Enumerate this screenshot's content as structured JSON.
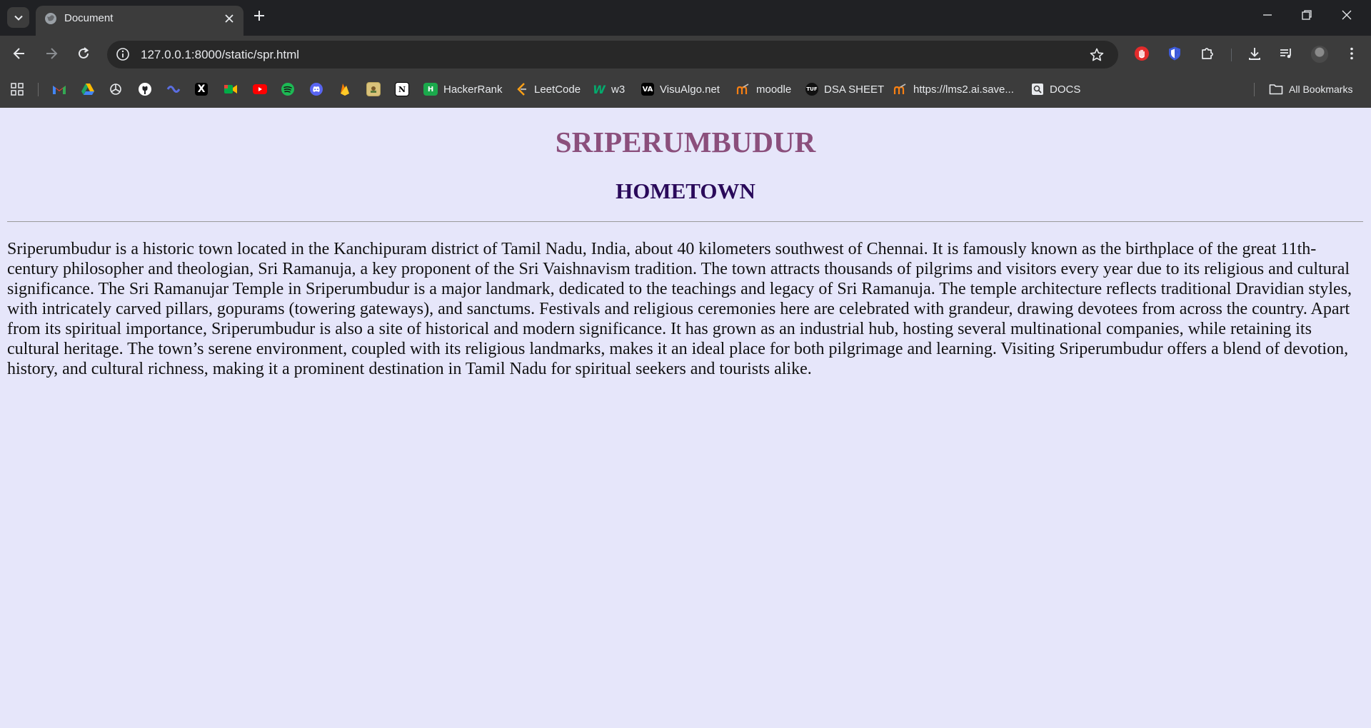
{
  "browser": {
    "tab": {
      "title": "Document"
    },
    "omnibox": {
      "url": "127.0.0.1:8000/static/spr.html"
    },
    "bookmarks": [
      {
        "label": "",
        "icon": "apps-grid-icon"
      },
      {
        "label": "",
        "icon": "gmail-icon",
        "color": "#ea4335"
      },
      {
        "label": "",
        "icon": "google-drive-icon",
        "color": "#1fa463"
      },
      {
        "label": "",
        "icon": "openai-icon",
        "color": "#e8eaed"
      },
      {
        "label": "",
        "icon": "github-icon",
        "color": "#ffffff"
      },
      {
        "label": "",
        "icon": "codeforces-icon",
        "color": "#5b6ee1"
      },
      {
        "label": "",
        "icon": "x-icon",
        "color": "#000000"
      },
      {
        "label": "",
        "icon": "google-meet-icon",
        "color": "#00ac47"
      },
      {
        "label": "",
        "icon": "youtube-icon",
        "color": "#ff0000"
      },
      {
        "label": "",
        "icon": "spotify-icon",
        "color": "#1db954"
      },
      {
        "label": "",
        "icon": "discord-icon",
        "color": "#5865f2"
      },
      {
        "label": "",
        "icon": "firebase-icon",
        "color": "#f57c00"
      },
      {
        "label": "",
        "icon": "image-bookmark-icon",
        "color": "#d9c27a"
      },
      {
        "label": "",
        "icon": "notion-icon",
        "color": "#ffffff"
      },
      {
        "label": "HackerRank",
        "icon": "hackerrank-icon",
        "color": "#1ba94c"
      },
      {
        "label": "LeetCode",
        "icon": "leetcode-icon",
        "color": "#ffa116"
      },
      {
        "label": "w3",
        "icon": "w3schools-icon",
        "color": "#04aa6d"
      },
      {
        "label": "VisuAlgo.net",
        "icon": "visualgo-icon",
        "color": "#ffffff"
      },
      {
        "label": "moodle",
        "icon": "moodle-icon",
        "color": "#f98012"
      },
      {
        "label": "DSA SHEET",
        "icon": "tuf-icon",
        "color": "#111111"
      },
      {
        "label": "https://lms2.ai.save...",
        "icon": "moodle-icon",
        "color": "#f98012"
      },
      {
        "label": "DOCS",
        "icon": "docs-search-icon",
        "color": "#e8eaed"
      }
    ],
    "all_bookmarks_label": "All Bookmarks"
  },
  "page": {
    "title": "SRIPERUMBUDUR",
    "subtitle": "HOMETOWN",
    "paragraph": "Sriperumbudur is a historic town located in the Kanchipuram district of Tamil Nadu, India, about 40 kilometers southwest of Chennai. It is famously known as the birthplace of the great 11th-century philosopher and theologian, Sri Ramanuja, a key proponent of the Sri Vaishnavism tradition. The town attracts thousands of pilgrims and visitors every year due to its religious and cultural significance. The Sri Ramanujar Temple in Sriperumbudur is a major landmark, dedicated to the teachings and legacy of Sri Ramanuja. The temple architecture reflects traditional Dravidian styles, with intricately carved pillars, gopurams (towering gateways), and sanctums. Festivals and religious ceremonies here are celebrated with grandeur, drawing devotees from across the country. Apart from its spiritual importance, Sriperumbudur is also a site of historical and modern significance. It has grown as an industrial hub, hosting several multinational companies, while retaining its cultural heritage. The town’s serene environment, coupled with its religious landmarks, makes it an ideal place for both pilgrimage and learning. Visiting Sriperumbudur offers a blend of devotion, history, and cultural richness, making it a prominent destination in Tamil Nadu for spiritual seekers and tourists alike.",
    "background": "#e6e6fa",
    "title_color": "#8b4f7c",
    "subtitle_color": "#2a0a5a"
  }
}
